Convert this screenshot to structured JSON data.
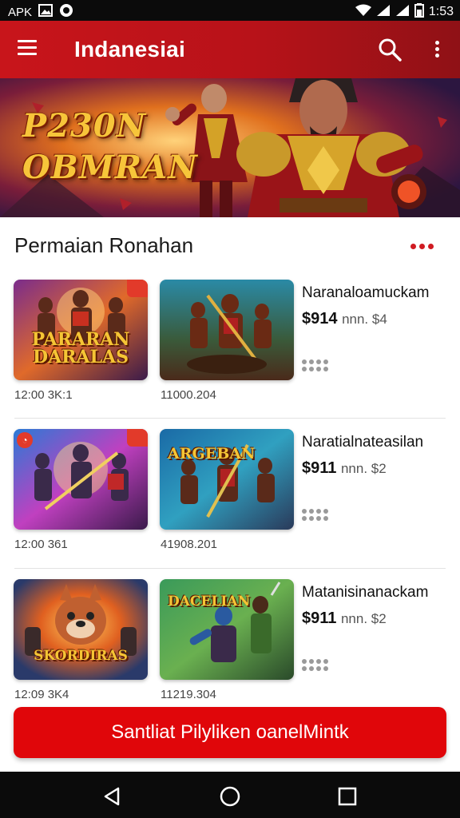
{
  "status_bar": {
    "left_label": "APK",
    "time": "1:53",
    "icons": [
      "image-icon",
      "circle-app-icon",
      "wifi-icon",
      "signal-icon",
      "signal-icon",
      "battery-icon"
    ]
  },
  "app_bar": {
    "title": "Indanesiai",
    "icons": [
      "menu-icon",
      "search-icon",
      "more-vert-icon"
    ]
  },
  "banner": {
    "line1": "P230N",
    "line2": "OBMRAN"
  },
  "section": {
    "title": "Permaian Ronahan"
  },
  "items": [
    {
      "name": "Naranaloamuckam",
      "price": "$914",
      "price_note": "nnn. $4",
      "thumb1_title": "PARARAN DARALAS",
      "thumb1_caption": "12:00 3K:1",
      "thumb2_caption": "11000.204"
    },
    {
      "name": "Naratialnateasilan",
      "price": "$911",
      "price_note": "nnn. $2",
      "thumb2_title": "ARGEBAN",
      "thumb1_caption": "12:00 361",
      "thumb2_caption": "41908.201"
    },
    {
      "name": "Matanisinanackam",
      "price": "$911",
      "price_note": "nnn. $2",
      "thumb1_title": "SKORDIRAS",
      "thumb2_title": "DACELIAN",
      "thumb1_caption": "12:09 3K4",
      "thumb2_caption": "11219.304"
    }
  ],
  "cta": {
    "label": "Santliat Pilyliken oanelMintk"
  },
  "nav_bar": {
    "icons": [
      "back-icon",
      "home-icon",
      "recents-icon"
    ]
  },
  "colors": {
    "brand_red": "#c8151b",
    "cta_red": "#e0060a",
    "title_gold": "#f5c535"
  }
}
